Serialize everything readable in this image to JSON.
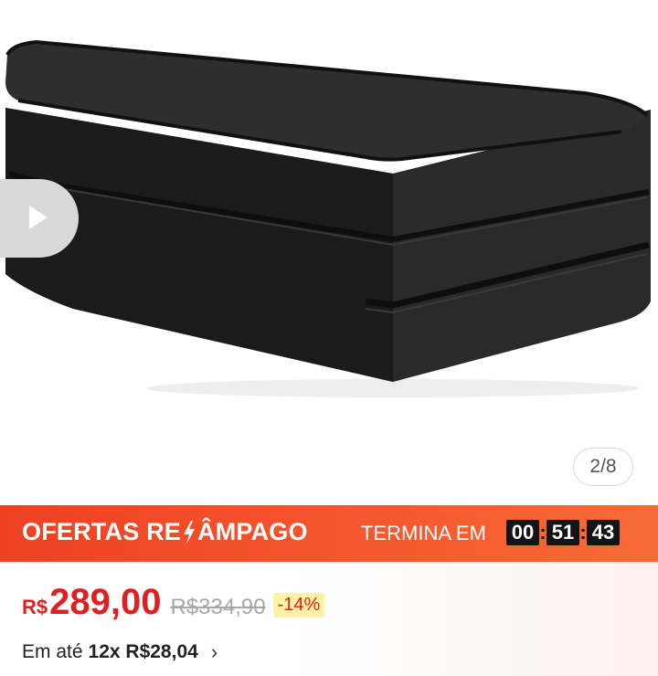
{
  "gallery": {
    "image_alt": "Colchão dobrável preto",
    "counter": "2/8",
    "play_icon": "play-icon"
  },
  "flash_sale": {
    "title_part1": "OFERTAS RE",
    "title_part2": "ÂMPAGO",
    "bolt_icon": "lightning-bolt-icon",
    "ends_label": "TERMINA EM",
    "timer": {
      "hours": "00",
      "minutes": "51",
      "seconds": "43"
    },
    "colors": {
      "bar_start": "#ee4123",
      "bar_end": "#f76b35"
    }
  },
  "pricing": {
    "currency": "R$",
    "price": "289,00",
    "original_price": "R$334,90",
    "discount": "-14%",
    "installment_prefix": "Em até",
    "installment_value": "12x R$28,04",
    "chevron_icon": "chevron-right-icon",
    "colors": {
      "price": "#e02020",
      "discount_bg": "#fff1a6"
    }
  }
}
